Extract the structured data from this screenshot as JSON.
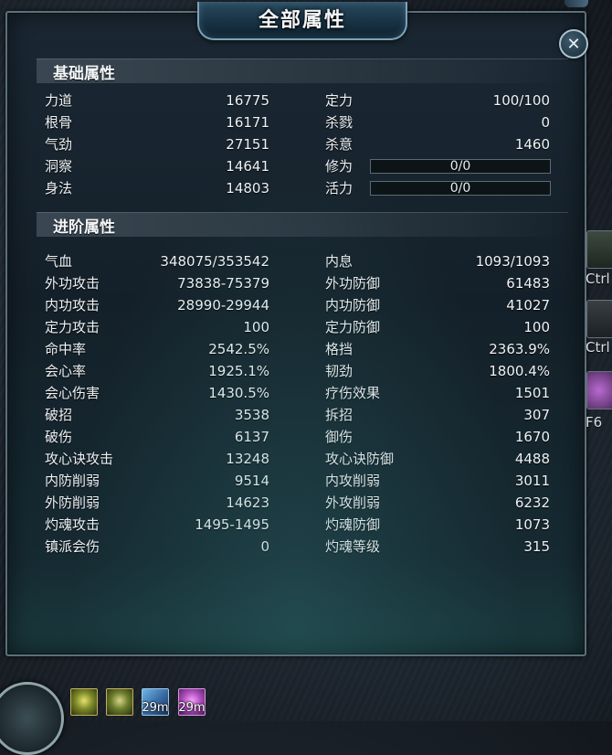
{
  "window": {
    "title": "全部属性",
    "close_label": "✕"
  },
  "basic": {
    "header": "基础属性",
    "left": [
      {
        "label": "力道",
        "value": "16775"
      },
      {
        "label": "根骨",
        "value": "16171"
      },
      {
        "label": "气劲",
        "value": "27151"
      },
      {
        "label": "洞察",
        "value": "14641"
      },
      {
        "label": "身法",
        "value": "14803"
      }
    ],
    "right": [
      {
        "label": "定力",
        "value": "100/100"
      },
      {
        "label": "杀戮",
        "value": "0"
      },
      {
        "label": "杀意",
        "value": "1460"
      }
    ],
    "bars": [
      {
        "label": "修为",
        "value": "0/0",
        "fill": 0
      },
      {
        "label": "活力",
        "value": "0/0",
        "fill": 0
      }
    ]
  },
  "advanced": {
    "header": "进阶属性",
    "left": [
      {
        "label": "气血",
        "value": "348075/353542"
      },
      {
        "label": "外功攻击",
        "value": "73838-75379"
      },
      {
        "label": "内功攻击",
        "value": "28990-29944"
      },
      {
        "label": "定力攻击",
        "value": "100"
      },
      {
        "label": "命中率",
        "value": "2542.5%"
      },
      {
        "label": "会心率",
        "value": "1925.1%"
      },
      {
        "label": "会心伤害",
        "value": "1430.5%"
      },
      {
        "label": "破招",
        "value": "3538"
      },
      {
        "label": "破伤",
        "value": "6137"
      },
      {
        "label": "攻心诀攻击",
        "value": "13248"
      },
      {
        "label": "内防削弱",
        "value": "9514"
      },
      {
        "label": "外防削弱",
        "value": "14623"
      },
      {
        "label": "灼魂攻击",
        "value": "1495-1495"
      },
      {
        "label": "镇派会伤",
        "value": "0"
      }
    ],
    "right": [
      {
        "label": "内息",
        "value": "1093/1093"
      },
      {
        "label": "外功防御",
        "value": "61483"
      },
      {
        "label": "内功防御",
        "value": "41027"
      },
      {
        "label": "定力防御",
        "value": "100"
      },
      {
        "label": "格挡",
        "value": "2363.9%"
      },
      {
        "label": "韧劲",
        "value": "1800.4%"
      },
      {
        "label": "疗伤效果",
        "value": "1501"
      },
      {
        "label": "拆招",
        "value": "307"
      },
      {
        "label": "御伤",
        "value": "1670"
      },
      {
        "label": "攻心诀防御",
        "value": "4488"
      },
      {
        "label": "内攻削弱",
        "value": "3011"
      },
      {
        "label": "外攻削弱",
        "value": "6232"
      },
      {
        "label": "灼魂防御",
        "value": "1073"
      },
      {
        "label": "灼魂等级",
        "value": "315"
      }
    ]
  },
  "side_shortcuts": [
    {
      "label": "Ctrl",
      "icon": "green-creature-icon"
    },
    {
      "label": "Ctrl",
      "icon": "dark-figure-icon"
    },
    {
      "label": "F6",
      "icon": "purple-orb-icon"
    }
  ],
  "buffs": [
    {
      "icon": "golden-figure-buff-icon",
      "timer": ""
    },
    {
      "icon": "golden-figure-buff-icon",
      "timer": ""
    },
    {
      "icon": "blue-scroll-buff-icon",
      "timer": "29m"
    },
    {
      "icon": "purple-orb-buff-icon",
      "timer": "29m"
    }
  ]
}
